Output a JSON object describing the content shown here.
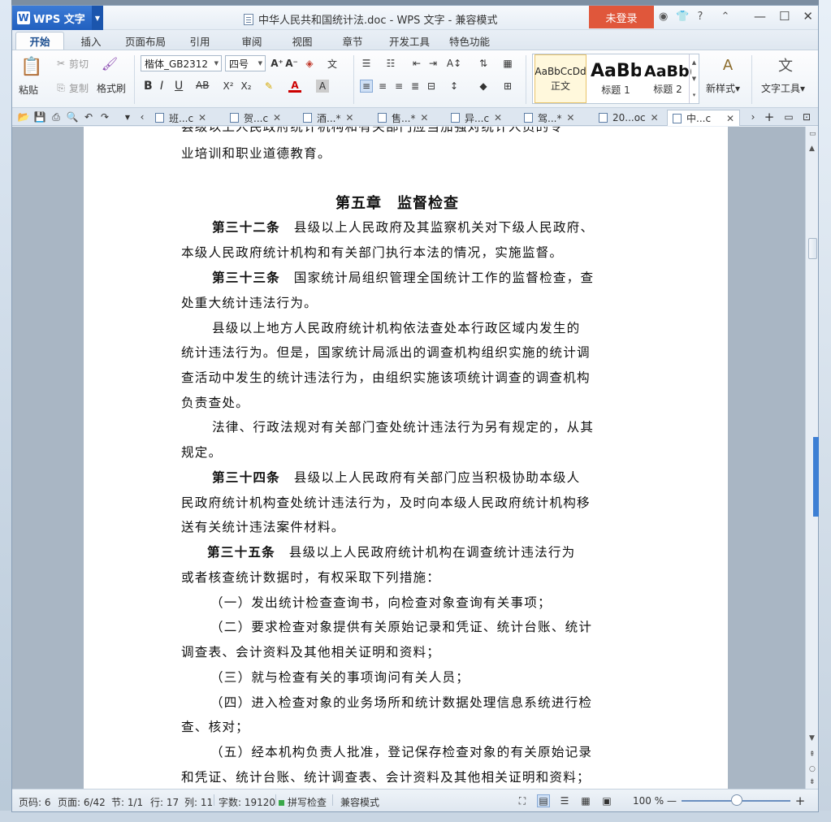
{
  "app": {
    "name": "WPS 文字",
    "logo": "W"
  },
  "window": {
    "title": "中华人民共和国统计法.doc - WPS 文字 - 兼容模式",
    "login": "未登录",
    "help": "?"
  },
  "menu_tabs": [
    "开始",
    "插入",
    "页面布局",
    "引用",
    "审阅",
    "视图",
    "章节",
    "开发工具",
    "特色功能"
  ],
  "ribbon": {
    "paste": "粘贴",
    "cut": "剪切",
    "copy": "复制",
    "format_painter": "格式刷",
    "font_name": "楷体_GB2312",
    "font_size": "四号",
    "bold": "B",
    "italic": "I",
    "underline": "U",
    "strike": "AB",
    "styles": [
      {
        "preview": "AaBbCcDd",
        "name": "正文"
      },
      {
        "preview": "AaBb",
        "name": "标题 1"
      },
      {
        "preview": "AaBb(",
        "name": "标题 2"
      }
    ],
    "new_style": "新样式",
    "text_tools": "文字工具"
  },
  "doc_tabs": [
    "班...c",
    "贺...c",
    "酒...*",
    "售...*",
    "异...c",
    "驾...*",
    "20...oc",
    "中...c"
  ],
  "document": {
    "lines": [
      {
        "text": "县级以上人民政府统计机构和有关部门应当加强对统计人员的专",
        "bold": ""
      },
      {
        "text": "业培训和职业道德教育。",
        "bold": ""
      },
      {
        "text": "县级以上人民政府及其监察机关对下级人民政府、",
        "bold": "第三十二条"
      },
      {
        "text": "本级人民政府统计机构和有关部门执行本法的情况，实施监督。",
        "bold": ""
      },
      {
        "text": "国家统计局组织管理全国统计工作的监督检查，查",
        "bold": "第三十三条"
      },
      {
        "text": "处重大统计违法行为。",
        "bold": ""
      },
      {
        "text": "县级以上地方人民政府统计机构依法查处本行政区域内发生的",
        "bold": ""
      },
      {
        "text": "统计违法行为。但是，国家统计局派出的调查机构组织实施的统计调",
        "bold": ""
      },
      {
        "text": "查活动中发生的统计违法行为，由组织实施该项统计调查的调查机构",
        "bold": ""
      },
      {
        "text": "负责查处。",
        "bold": ""
      },
      {
        "text": "法律、行政法规对有关部门查处统计违法行为另有规定的，从其",
        "bold": ""
      },
      {
        "text": "规定。",
        "bold": ""
      },
      {
        "text": "县级以上人民政府有关部门应当积极协助本级人",
        "bold": "第三十四条"
      },
      {
        "text": "民政府统计机构查处统计违法行为，及时向本级人民政府统计机构移",
        "bold": ""
      },
      {
        "text": "送有关统计违法案件材料。",
        "bold": ""
      },
      {
        "text": "县级以上人民政府统计机构在调查统计违法行为",
        "bold": "第三十五条"
      },
      {
        "text": "或者核查统计数据时，有权采取下列措施：",
        "bold": ""
      },
      {
        "text": "（一）发出统计检查查询书，向检查对象查询有关事项；",
        "bold": ""
      },
      {
        "text": "（二）要求检查对象提供有关原始记录和凭证、统计台账、统计",
        "bold": ""
      },
      {
        "text": "调查表、会计资料及其他相关证明和资料；",
        "bold": ""
      },
      {
        "text": "（三）就与检查有关的事项询问有关人员；",
        "bold": ""
      },
      {
        "text": "（四）进入检查对象的业务场所和统计数据处理信息系统进行检",
        "bold": ""
      },
      {
        "text": "查、核对；",
        "bold": ""
      },
      {
        "text": "（五）经本机构负责人批准，登记保存检查对象的有关原始记录",
        "bold": ""
      },
      {
        "text": "和凭证、统计台账、统计调查表、会计资料及其他相关证明和资料；",
        "bold": ""
      }
    ],
    "chapter": "第五章　监督检查"
  },
  "status": {
    "page_code": "页码: 6",
    "pages": "页面: 6/42",
    "section": "节: 1/1",
    "row": "行: 17",
    "col": "列: 11",
    "words": "字数: 19120",
    "spell": "拼写检查",
    "mode": "兼容模式",
    "zoom": "100 %"
  }
}
